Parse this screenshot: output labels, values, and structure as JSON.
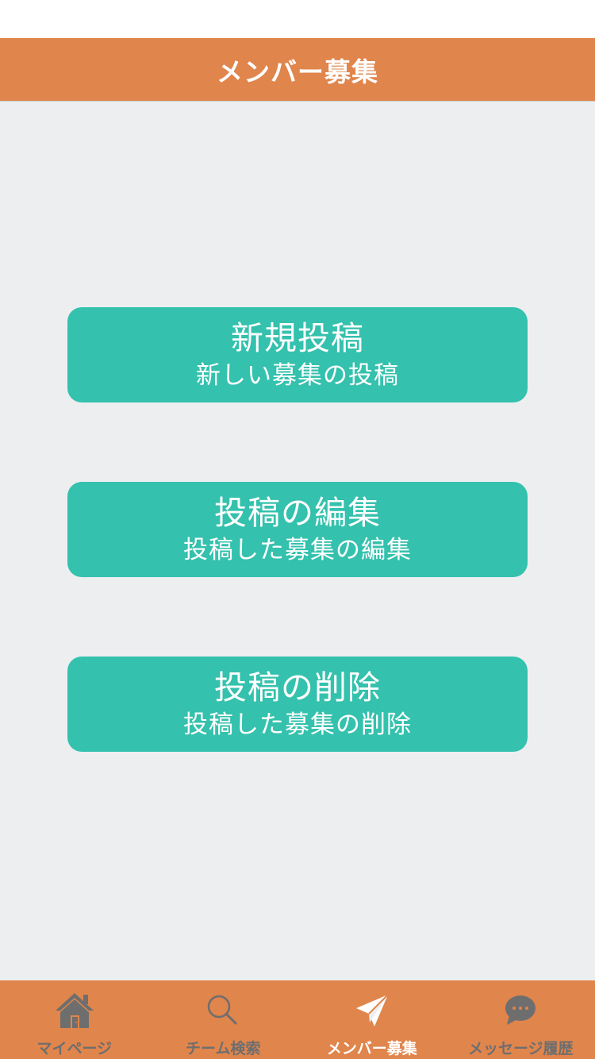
{
  "header": {
    "title": "メンバー募集"
  },
  "menu": [
    {
      "title": "新規投稿",
      "subtitle": "新しい募集の投稿"
    },
    {
      "title": "投稿の編集",
      "subtitle": "投稿した募集の編集"
    },
    {
      "title": "投稿の削除",
      "subtitle": "投稿した募集の削除"
    }
  ],
  "tabs": [
    {
      "label": "マイページ",
      "icon": "house-icon"
    },
    {
      "label": "チーム検索",
      "icon": "search-icon"
    },
    {
      "label": "メンバー募集",
      "icon": "paper-plane-icon",
      "active": true
    },
    {
      "label": "メッセージ履歴",
      "icon": "chat-bubble-icon"
    }
  ],
  "colors": {
    "accent": "#e0854c",
    "button": "#34c1ad",
    "background": "#edeef0",
    "tab_inactive": "#6e6e6e",
    "tab_active": "#ffffff"
  }
}
